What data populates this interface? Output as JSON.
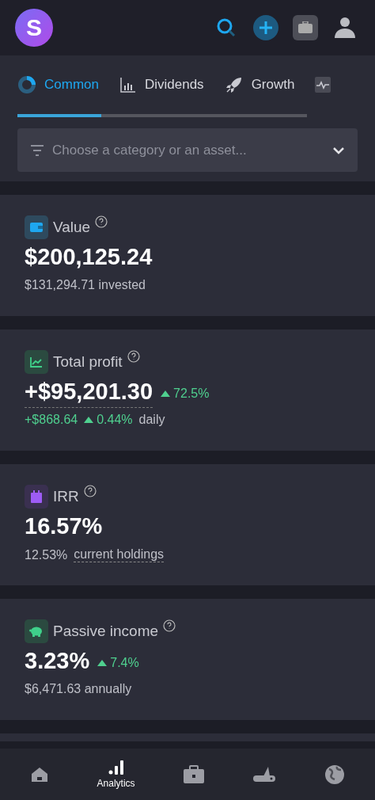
{
  "header": {
    "logo": "S"
  },
  "tabs": [
    {
      "label": "Common",
      "selected": true
    },
    {
      "label": "Dividends",
      "selected": false
    },
    {
      "label": "Growth",
      "selected": false
    },
    {
      "selected": false
    }
  ],
  "tab_scroll": {
    "level": 0.29
  },
  "filter": {
    "placeholder": "Choose a category or an asset..."
  },
  "cards": [
    {
      "title": "Value",
      "color": "#1ea7f0",
      "value": "$200,125.24",
      "underlined": false,
      "sub": [
        {
          "kind": "plain",
          "text": "$131,294.71 invested"
        }
      ]
    },
    {
      "title": "Total profit",
      "color": "#3fd08a",
      "value": "+$95,201.30",
      "underlined": true,
      "change": "72.5%",
      "sub": [
        {
          "kind": "positive",
          "text": "+$868.64"
        },
        {
          "kind": "change",
          "text": "0.44%"
        },
        {
          "kind": "plain",
          "text": "daily"
        }
      ]
    },
    {
      "title": "IRR",
      "color": "#9d5cf5",
      "value": "16.57%",
      "underlined": false,
      "sub": [
        {
          "kind": "plain",
          "text": "12.53%"
        },
        {
          "kind": "dotted",
          "text": "current holdings"
        }
      ]
    },
    {
      "title": "Passive income",
      "color": "#3fd08a",
      "value": "3.23%",
      "underlined": false,
      "change": "7.4%",
      "sub": [
        {
          "kind": "plain",
          "text": "$6,471.63 annually"
        }
      ]
    }
  ],
  "bottom_nav": [
    {
      "selected": false
    },
    {
      "label": "Analytics",
      "selected": true
    },
    {
      "selected": false
    },
    {
      "selected": false
    },
    {
      "selected": false
    }
  ]
}
